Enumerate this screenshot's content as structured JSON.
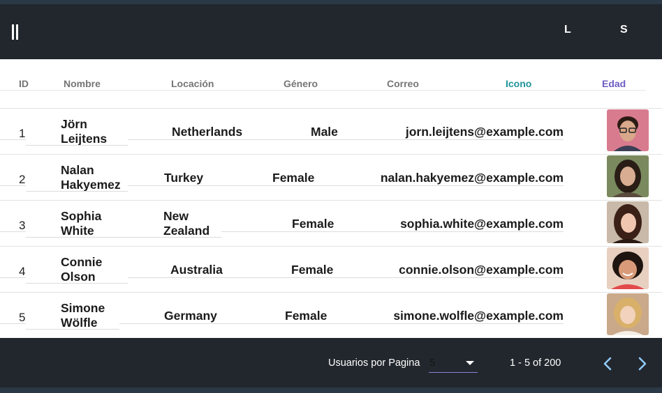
{
  "appbar": {
    "btn_l": "L",
    "btn_s": "S"
  },
  "table": {
    "headers": {
      "id": "ID",
      "nombre": "Nombre",
      "locacion": "Locación",
      "genero": "Género",
      "correo": "Correo",
      "icono": "Icono",
      "edad": "Edad"
    },
    "rows": [
      {
        "id": "1",
        "first": "Jörn",
        "last": "Leijtens",
        "loc1": "Netherlands",
        "loc2": "",
        "gender": "Male",
        "email": "jorn.leijtens@example.com",
        "avatar": "avatar-male-glasses"
      },
      {
        "id": "2",
        "first": "Nalan",
        "last": "Hakyemez",
        "loc1": "Turkey",
        "loc2": "",
        "gender": "Female",
        "email": "nalan.hakyemez@example.com",
        "avatar": "avatar-female-dark-hair"
      },
      {
        "id": "3",
        "first": "Sophia",
        "last": "White",
        "loc1": "New",
        "loc2": "Zealand",
        "gender": "Female",
        "email": "sophia.white@example.com",
        "avatar": "avatar-female-brunette"
      },
      {
        "id": "4",
        "first": "Connie",
        "last": "Olson",
        "loc1": "Australia",
        "loc2": "",
        "gender": "Female",
        "email": "connie.olson@example.com",
        "avatar": "avatar-female-smiling"
      },
      {
        "id": "5",
        "first": "Simone",
        "last": "Wölfle",
        "loc1": "Germany",
        "loc2": "",
        "gender": "Female",
        "email": "simone.wolfle@example.com",
        "avatar": "avatar-female-blonde"
      }
    ]
  },
  "footer": {
    "per_page_label": "Usuarios por Pagina",
    "per_page_value": "5",
    "range": "1 - 5 of 200",
    "prev_icon": "chevron-left-icon",
    "next_icon": "chevron-right-icon"
  },
  "colors": {
    "appbar": "#22272d",
    "icono_header": "#1e9499",
    "edad_header": "#6c5cc4",
    "nav_icon": "#90caf9",
    "select_underline": "#8c83d8"
  }
}
